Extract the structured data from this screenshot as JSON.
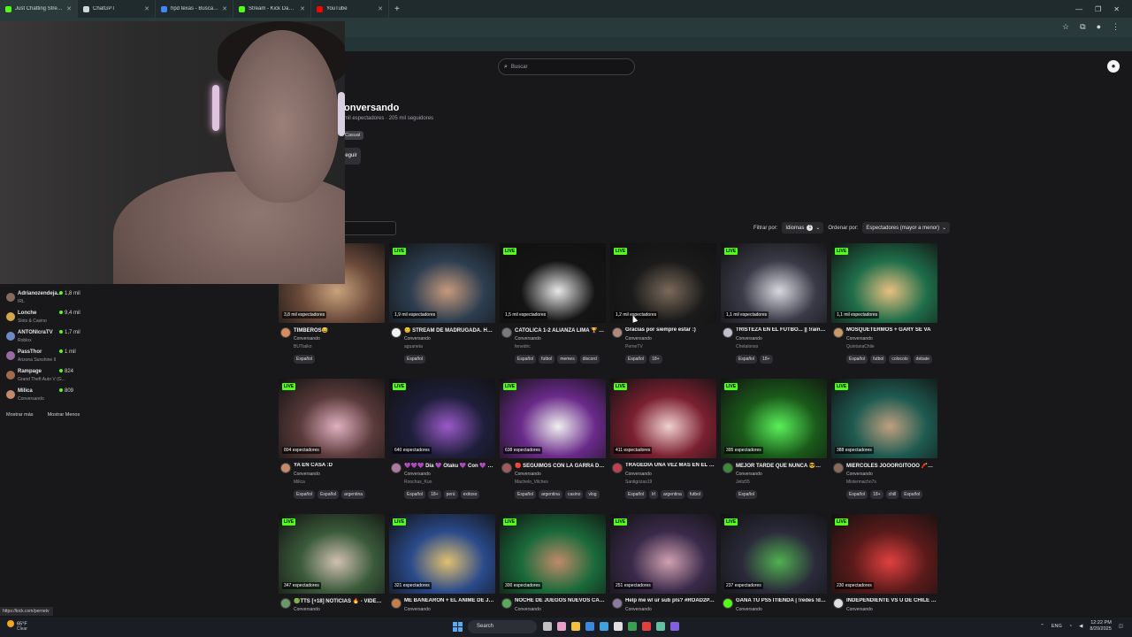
{
  "browser": {
    "tabs": [
      {
        "title": "Just Chatting Streaming - Live",
        "fav": "#53fc18",
        "active": true
      },
      {
        "title": "ChatGPT",
        "fav": "#cfd8d8",
        "active": false
      },
      {
        "title": "hpd texas - Buscar con Google",
        "fav": "#4285f4",
        "active": false
      },
      {
        "title": "Stream - Kick Dashboard",
        "fav": "#53fc18",
        "active": false
      },
      {
        "title": "YouTube",
        "fav": "#ff0000",
        "active": false
      }
    ],
    "new_tab": "+",
    "status_url": "https://kick.com/pernetv"
  },
  "header": {
    "search_placeholder": "Buscar"
  },
  "category": {
    "title": "onversando",
    "stats": "mil espectadores · 205 mil seguidores",
    "tag": "Casual",
    "follow_label": "eguir"
  },
  "filters": {
    "filter_label": "Filtrar por:",
    "languages_label": "Idiomas",
    "languages_count": "1",
    "sort_label": "Ordenar por:",
    "sort_value": "Espectadores (mayor a menor)"
  },
  "sidebar": {
    "items": [
      {
        "name": "Adrianozendeja...",
        "sub": "IRL",
        "viewers": "1,8 mil",
        "color": "#8a6a5a"
      },
      {
        "name": "Lonche",
        "sub": "Slots & Casino",
        "viewers": "9,4 mil",
        "color": "#d4a84a"
      },
      {
        "name": "ANTONIcraTV",
        "sub": "Roblox",
        "viewers": "1,7 mil",
        "color": "#6a8ac4"
      },
      {
        "name": "PassThor",
        "sub": "Arizona Sunshine II",
        "viewers": "1 mil",
        "color": "#9a6aa4"
      },
      {
        "name": "Rampage",
        "sub": "Grand Theft Auto V (G...",
        "viewers": "824",
        "color": "#a46a4a"
      },
      {
        "name": "Milica",
        "sub": "Conversando",
        "viewers": "809",
        "color": "#c48a6a"
      }
    ],
    "show_more": "Mostrar más",
    "show_less": "Mostrar Menos"
  },
  "cards": [
    {
      "viewers": "3,8 mil espectadores",
      "title": "TIMBEROS😅",
      "cat": "Conversando",
      "user": "BUTtaiko",
      "tags": [
        "Español"
      ],
      "thumb": "#6b4a3a",
      "accent": "#c9a27d",
      "avatar": "#d98c5f"
    },
    {
      "viewers": "1,9 mil espectadores",
      "title": "😊 STREAM DE MADRUGADA. HABL...",
      "cat": "Conversando",
      "user": "aguaneta",
      "tags": [
        "Español"
      ],
      "thumb": "#2d3e50",
      "accent": "#c79a7c",
      "avatar": "#f2f2f2"
    },
    {
      "viewers": "1,5 mil espectadores",
      "title": "CATÓLICA 1-2 ALIANZA LIMA 🏆 LA ...",
      "cat": "Conversando",
      "user": "fenedric",
      "tags": [
        "Español",
        "futbol",
        "memes",
        "discord"
      ],
      "thumb": "#141414",
      "accent": "#e8e8e8",
      "avatar": "#7a7a7a"
    },
    {
      "viewers": "1,2 mil espectadores",
      "title": "Gracias por siempre estar :)",
      "cat": "Conversando",
      "user": "PerneTV",
      "tags": [
        "Español",
        "18+"
      ],
      "thumb": "#1a1a1a",
      "accent": "#7a6a5a",
      "avatar": "#b08a7a"
    },
    {
      "viewers": "1,1 mil espectadores",
      "title": "TRISTEZA EN EL FUTBO... || !rainbet",
      "cat": "Conversando",
      "user": "Chetalonso",
      "tags": [
        "Español",
        "18+"
      ],
      "thumb": "#3a3a48",
      "accent": "#d8d8e0",
      "avatar": "#c0c0d0"
    },
    {
      "viewers": "1,1 mil espectadores",
      "title": "MOSQUETERMOS + GARY SE VA",
      "cat": "Conversando",
      "user": "QuintanaChile",
      "tags": [
        "Español",
        "futbol",
        "colocolo",
        "debate"
      ],
      "thumb": "#1f6e4a",
      "accent": "#e8c080",
      "avatar": "#c89a6a"
    },
    {
      "viewers": "804 espectadores",
      "title": "YA EN CASA :D",
      "cat": "Conversando",
      "user": "Milica",
      "tags": [
        "Español",
        "Español",
        "argentina"
      ],
      "thumb": "#5a3a3a",
      "accent": "#e0b0c0",
      "avatar": "#c48a6a"
    },
    {
      "viewers": "640 espectadores",
      "title": "💜💜💜 Día 💜 Otaku 💜 Con 💜 Zinga...",
      "cat": "Conversando",
      "user": "Roochas_Kun",
      "tags": [
        "Español",
        "18+",
        "perú",
        "exitoso"
      ],
      "thumb": "#1e1e3a",
      "accent": "#9a5ac8",
      "avatar": "#b07aa0"
    },
    {
      "viewers": "638 espectadores",
      "title": "🔴 SEGUIMOS CON LA GARRA DE P...",
      "cat": "Conversando",
      "user": "Machelo_Vilches",
      "tags": [
        "Español",
        "argentina",
        "casino",
        "vlog"
      ],
      "thumb": "#6a2a8a",
      "accent": "#f0f0f0",
      "avatar": "#a05a5a"
    },
    {
      "viewers": "411 espectadores",
      "title": "TRAGEDIA UNA VEZ MÁS EN EL FUT...",
      "cat": "Conversando",
      "user": "Santigrizas19",
      "tags": [
        "Español",
        "lrl",
        "argentina",
        "futbol"
      ],
      "thumb": "#7a2030",
      "accent": "#f0d0d0",
      "avatar": "#c04050"
    },
    {
      "viewers": "395 espectadores",
      "title": "MEJOR TARDE QUE NUNCA 😎🔵🔴 ...",
      "cat": "Conversando",
      "user": "Jeitz55",
      "tags": [
        "Español"
      ],
      "thumb": "#1a5a1a",
      "accent": "#5af05a",
      "avatar": "#3a8a3a"
    },
    {
      "viewers": "388 espectadores",
      "title": "MIERCOLES JOOORGITOOO 🧨😋 ...",
      "cat": "Conversando",
      "user": "Mistermacho7s",
      "tags": [
        "Español",
        "18+",
        "chill",
        "Español"
      ],
      "thumb": "#1e5a50",
      "accent": "#c0a080",
      "avatar": "#8a6a5a"
    },
    {
      "viewers": "347 espectadores",
      "title": "🟢TTS [+18] NOTICIAS 🔥 - VIDEOS ...",
      "cat": "Conversando",
      "user": "",
      "tags": [],
      "thumb": "#3a5a3a",
      "accent": "#d0c0b0",
      "avatar": "#6a9a6a"
    },
    {
      "viewers": "321 espectadores",
      "title": "ME BANEARON + EL ANIME DE JUA...",
      "cat": "Conversando",
      "user": "",
      "tags": [],
      "thumb": "#2a4a8a",
      "accent": "#e0c070",
      "avatar": "#c08050"
    },
    {
      "viewers": "300 espectadores",
      "title": "NOCHE DE JUEGOS NUEVOS CASIN...",
      "cat": "Conversando",
      "user": "",
      "tags": [],
      "thumb": "#1a6a3a",
      "accent": "#c08a6a",
      "avatar": "#5aaa5a"
    },
    {
      "viewers": "251 espectadores",
      "title": "Help me w/ ur sub pls? #ROAD2PAR...",
      "cat": "Conversando",
      "user": "",
      "tags": [],
      "thumb": "#3a2a4a",
      "accent": "#d0a0b0",
      "avatar": "#8a7aa0"
    },
    {
      "viewers": "237 espectadores",
      "title": "GANA TU PS5 ITIENDA | !redes !dc !...",
      "cat": "Conversando",
      "user": "",
      "tags": [],
      "thumb": "#2a2a3a",
      "accent": "#50b050",
      "avatar": "#53fc18"
    },
    {
      "viewers": "230 espectadores",
      "title": "INDEPENDIENTE VS U DE CHILE | RE...",
      "cat": "Conversando",
      "user": "",
      "tags": [],
      "thumb": "#5a1a1a",
      "accent": "#e04040",
      "avatar": "#e0e0e0"
    }
  ],
  "taskbar": {
    "temp": "65°F",
    "weather": "Clear",
    "search": "Search",
    "lang": "ENG",
    "time": "12:22 PM",
    "date": "8/20/2025"
  }
}
